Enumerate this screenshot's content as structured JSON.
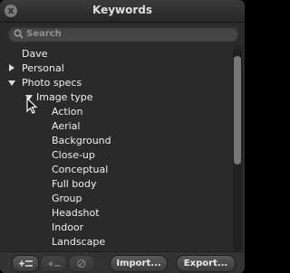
{
  "window": {
    "title": "Keywords",
    "close_glyph": "x"
  },
  "search": {
    "placeholder": "Search",
    "value": ""
  },
  "tree": [
    {
      "label": "Dave",
      "toggle": "none"
    },
    {
      "label": "Personal",
      "toggle": "closed"
    },
    {
      "label": "Photo specs",
      "toggle": "open"
    },
    {
      "label": "Image type",
      "toggle": "open"
    },
    {
      "label": "Action",
      "toggle": "none"
    },
    {
      "label": "Aerial",
      "toggle": "none"
    },
    {
      "label": "Background",
      "toggle": "none"
    },
    {
      "label": "Close-up",
      "toggle": "none"
    },
    {
      "label": "Conceptual",
      "toggle": "none"
    },
    {
      "label": "Full body",
      "toggle": "none"
    },
    {
      "label": "Group",
      "toggle": "none"
    },
    {
      "label": "Headshot",
      "toggle": "none"
    },
    {
      "label": "Indoor",
      "toggle": "none"
    },
    {
      "label": "Landscape",
      "toggle": "none"
    }
  ],
  "bottom": {
    "add_keyword_icon": "add-keyword-icon",
    "add_subkeyword_icon": "add-subkeyword-icon",
    "remove_icon": "remove-icon",
    "import_label": "Import...",
    "export_label": "Export..."
  },
  "colors": {
    "background": "#2a2a2a",
    "text": "#f0f0f0",
    "accent": "#777777"
  }
}
